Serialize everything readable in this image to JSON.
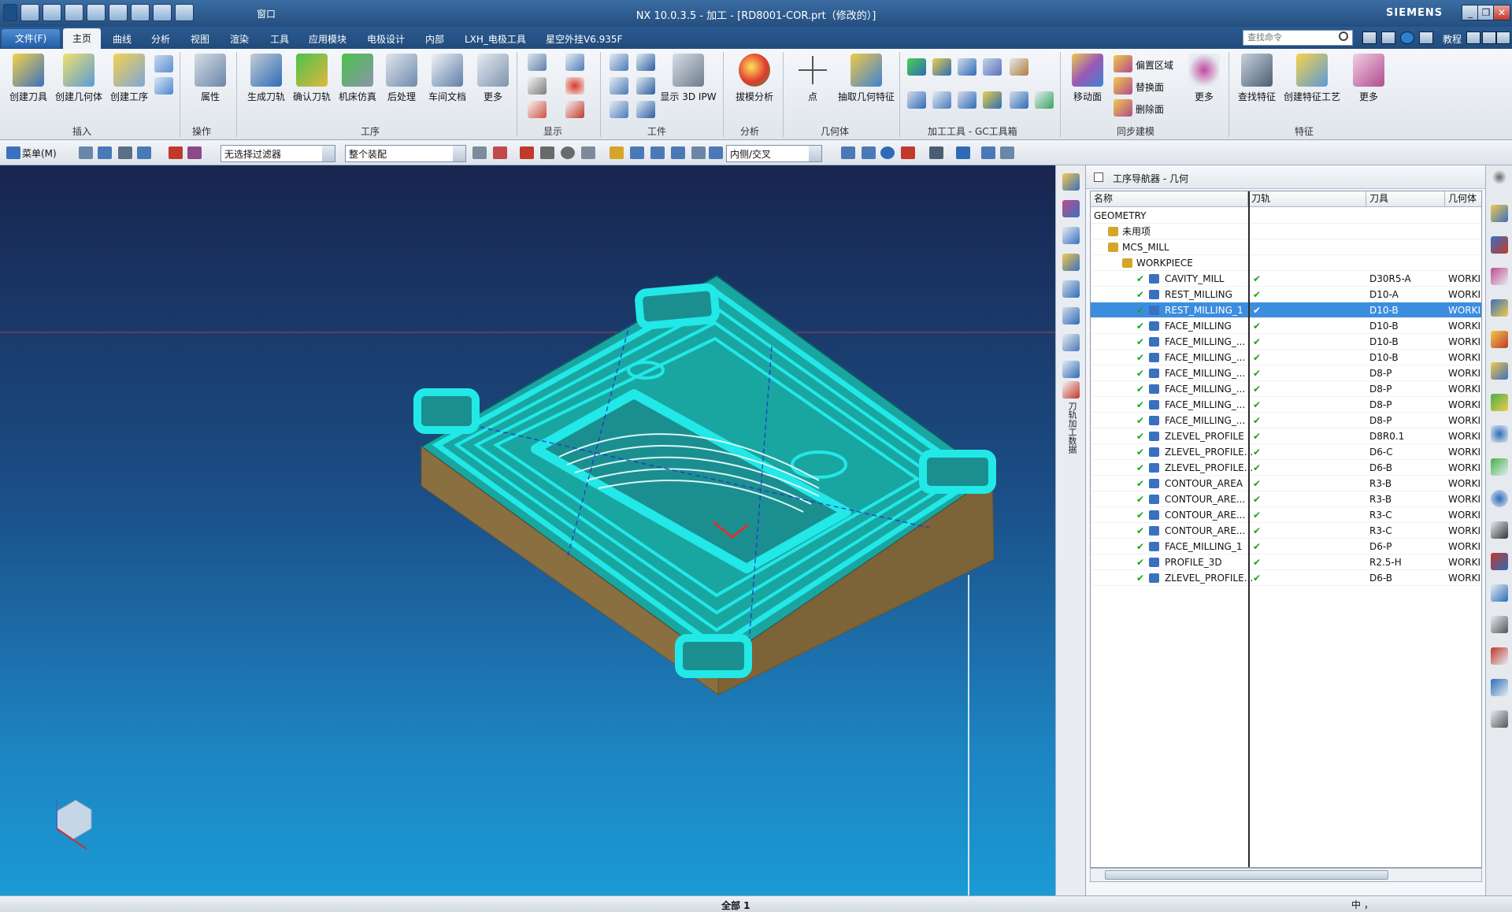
{
  "titlebar": {
    "window_menu": "窗口",
    "title": "NX 10.0.3.5 - 加工 - [RD8001-COR.prt（修改的）]",
    "brand": "SIEMENS"
  },
  "menubar": {
    "file": "文件(F)",
    "tabs": [
      "主页",
      "曲线",
      "分析",
      "视图",
      "渲染",
      "工具",
      "应用模块",
      "电极设计",
      "内部",
      "LXH_电极工具",
      "星空外挂V6.935F"
    ],
    "active_tab": "主页",
    "search_placeholder": "查找命令",
    "help": "教程"
  },
  "ribbon": {
    "insert": {
      "items": [
        "创建刀具",
        "创建几何体",
        "创建工序"
      ],
      "group": "插入"
    },
    "operation": {
      "items": [
        "属性"
      ],
      "group": "操作"
    },
    "process": {
      "items": [
        "生成刀轨",
        "确认刀轨",
        "机床仿真",
        "后处理",
        "车间文档",
        "更多"
      ],
      "group": "工序"
    },
    "display": {
      "group": "显示"
    },
    "workpiece": {
      "items": [
        "显示 3D IPW"
      ],
      "group": "工件"
    },
    "analysis": {
      "items": [
        "拔模分析"
      ],
      "group": "分析"
    },
    "geometry": {
      "items": [
        "点",
        "抽取几何特征"
      ],
      "group": "几何体"
    },
    "gc_tools": {
      "group": "加工工具 - GC工具箱"
    },
    "sync": {
      "items": [
        "移动面",
        "偏置区域",
        "替换面",
        "删除面",
        "更多"
      ],
      "group": "同步建模"
    },
    "feature": {
      "items": [
        "查找特征",
        "创建特征工艺",
        "更多"
      ],
      "group": "特征"
    }
  },
  "toolbar2": {
    "menu": "菜单(M)",
    "filter": "无选择过滤器",
    "assembly": "整个装配",
    "intersect": "内侧/交叉"
  },
  "resource_bar": {
    "vertical_label": "刀轨加工数据"
  },
  "navigator": {
    "title": "工序导航器 - 几何",
    "columns": [
      "名称",
      "刀轨",
      "刀具",
      "几何体"
    ],
    "tree": [
      {
        "name": "GEOMETRY",
        "level": 0,
        "path": "",
        "tool": "",
        "geom": ""
      },
      {
        "name": "未用项",
        "level": 1,
        "path": "",
        "tool": "",
        "geom": ""
      },
      {
        "name": "MCS_MILL",
        "level": 1,
        "path": "",
        "tool": "",
        "geom": ""
      },
      {
        "name": "WORKPIECE",
        "level": 2,
        "path": "",
        "tool": "",
        "geom": ""
      },
      {
        "name": "CAVITY_MILL",
        "level": 3,
        "path": "✔",
        "tool": "D30R5-A",
        "geom": "WORKI"
      },
      {
        "name": "REST_MILLING",
        "level": 3,
        "path": "✔",
        "tool": "D10-A",
        "geom": "WORKI"
      },
      {
        "name": "REST_MILLING_1",
        "level": 3,
        "path": "✔",
        "tool": "D10-B",
        "geom": "WORKI",
        "selected": true
      },
      {
        "name": "FACE_MILLING",
        "level": 3,
        "path": "✔",
        "tool": "D10-B",
        "geom": "WORKI"
      },
      {
        "name": "FACE_MILLING_...",
        "level": 3,
        "path": "✔",
        "tool": "D10-B",
        "geom": "WORKI"
      },
      {
        "name": "FACE_MILLING_...",
        "level": 3,
        "path": "✔",
        "tool": "D10-B",
        "geom": "WORKI"
      },
      {
        "name": "FACE_MILLING_...",
        "level": 3,
        "path": "✔",
        "tool": "D8-P",
        "geom": "WORKI"
      },
      {
        "name": "FACE_MILLING_...",
        "level": 3,
        "path": "✔",
        "tool": "D8-P",
        "geom": "WORKI"
      },
      {
        "name": "FACE_MILLING_...",
        "level": 3,
        "path": "✔",
        "tool": "D8-P",
        "geom": "WORKI"
      },
      {
        "name": "FACE_MILLING_...",
        "level": 3,
        "path": "✔",
        "tool": "D8-P",
        "geom": "WORKI"
      },
      {
        "name": "ZLEVEL_PROFILE",
        "level": 3,
        "path": "✔",
        "tool": "D8R0.1",
        "geom": "WORKI"
      },
      {
        "name": "ZLEVEL_PROFILE...",
        "level": 3,
        "path": "✔",
        "tool": "D6-C",
        "geom": "WORKI"
      },
      {
        "name": "ZLEVEL_PROFILE...",
        "level": 3,
        "path": "✔",
        "tool": "D6-B",
        "geom": "WORKI"
      },
      {
        "name": "CONTOUR_AREA",
        "level": 3,
        "path": "✔",
        "tool": "R3-B",
        "geom": "WORKI"
      },
      {
        "name": "CONTOUR_ARE...",
        "level": 3,
        "path": "✔",
        "tool": "R3-B",
        "geom": "WORKI"
      },
      {
        "name": "CONTOUR_ARE...",
        "level": 3,
        "path": "✔",
        "tool": "R3-C",
        "geom": "WORKI"
      },
      {
        "name": "CONTOUR_ARE...",
        "level": 3,
        "path": "✔",
        "tool": "R3-C",
        "geom": "WORKI"
      },
      {
        "name": "FACE_MILLING_1",
        "level": 3,
        "path": "✔",
        "tool": "D6-P",
        "geom": "WORKI"
      },
      {
        "name": "PROFILE_3D",
        "level": 3,
        "path": "✔",
        "tool": "R2.5-H",
        "geom": "WORKI"
      },
      {
        "name": "ZLEVEL_PROFILE...",
        "level": 3,
        "path": "✔",
        "tool": "D6-B",
        "geom": "WORKI"
      }
    ]
  },
  "statusbar": {
    "center": "全部 1",
    "ime": "中 ，"
  },
  "colors": {
    "toolpath": "#22e8e8",
    "part_top": "#1aa6a0",
    "part_side": "#8a7040",
    "selection": "#3c8de0"
  }
}
